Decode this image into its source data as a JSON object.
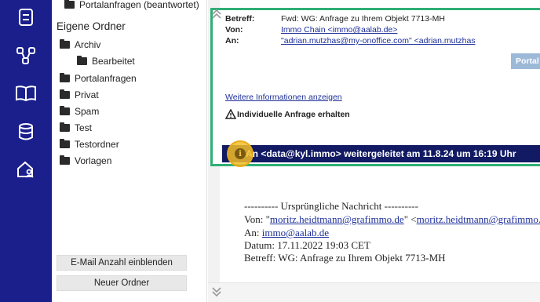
{
  "rail": {
    "icons": [
      "document-stack-icon",
      "network-nodes-icon",
      "open-book-icon",
      "database-icon",
      "home-user-icon"
    ]
  },
  "folders": {
    "top_item": "Portalanfragen (beantwortet)",
    "section_title": "Eigene Ordner",
    "items": [
      {
        "label": "Archiv"
      },
      {
        "label": "Bearbeitet"
      },
      {
        "label": "Portalanfragen"
      },
      {
        "label": "Privat"
      },
      {
        "label": "Spam"
      },
      {
        "label": "Test"
      },
      {
        "label": "Testordner"
      },
      {
        "label": "Vorlagen"
      }
    ],
    "show_count_button": "E-Mail Anzahl einblenden",
    "new_folder_button": "Neuer Ordner"
  },
  "header": {
    "subject_label": "Betreff:",
    "subject_value": "Fwd: WG: Anfrage zu Ihrem Objekt 7713-MH",
    "from_label": "Von:",
    "from_value": "Immo Chain <immo@aalab.de>",
    "to_label": "An:",
    "to_value": "\"adrian.mutzhas@my-onoffice.com\" <adrian.mutzhas",
    "portal_button": "Portal",
    "more_info_link": "Weitere Informationen anzeigen",
    "individual_request": "Individuelle Anfrage erhalten",
    "forwarded_bar": "An <data@kyl.immo> weitergeleitet am 11.8.24 um 16:19 Uhr"
  },
  "message": {
    "divider": "---------- Ursprüngliche Nachricht ----------",
    "from_prefix": "Von: \"",
    "from_link": "moritz.heidtmann@grafimmo.de",
    "from_mid": "\" <",
    "from_link2": "moritz.heidtmann@grafimmo.de",
    "to_prefix": "An: ",
    "to_link": "immo@aalab.de",
    "date_line": "Datum: 17.11.2022 19:03 CET",
    "subject_line": "Betreff: WG: Anfrage zu Ihrem Objekt 7713-MH"
  }
}
